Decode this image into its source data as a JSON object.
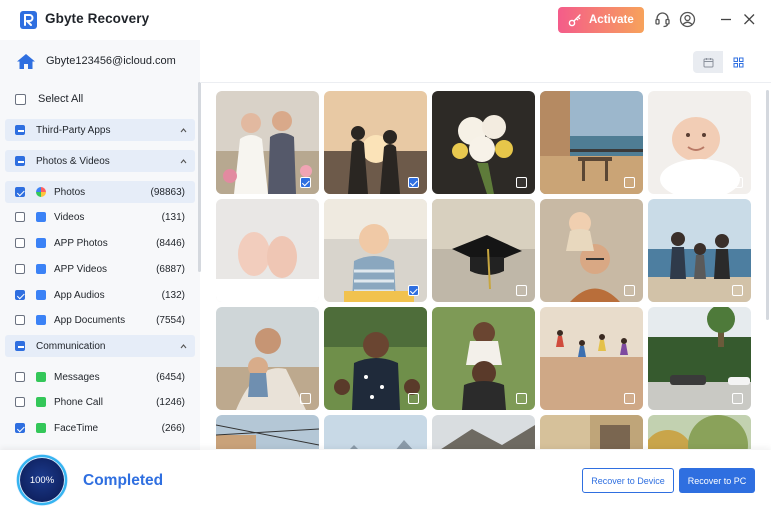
{
  "app": {
    "title": "Gbyte Recovery",
    "activate_label": "Activate",
    "colors": {
      "accent": "#2f6fe0",
      "activate_start": "#f45c8a",
      "activate_end": "#f7a25b"
    }
  },
  "titlebar_icons": [
    "headset-icon",
    "user-icon",
    "minimize-icon",
    "close-icon"
  ],
  "account": {
    "email": "Gbyte123456@icloud.com"
  },
  "sidebar": {
    "select_all_label": "Select All",
    "sections": [
      {
        "label": "Third-Party Apps",
        "state": "partial",
        "expanded": true
      },
      {
        "label": "Photos & Videos",
        "state": "partial",
        "expanded": true,
        "items": [
          {
            "label": "Photos",
            "count": "(98863)",
            "checked": true,
            "icon": "photos-icon",
            "color": "#ff6a6a"
          },
          {
            "label": "Videos",
            "count": "(131)",
            "checked": false,
            "icon": "videos-icon",
            "color": "#3b82f6"
          },
          {
            "label": "APP Photos",
            "count": "(8446)",
            "checked": false,
            "icon": "app-photos-icon",
            "color": "#3b82f6"
          },
          {
            "label": "APP Videos",
            "count": "(6887)",
            "checked": false,
            "icon": "app-videos-icon",
            "color": "#3b82f6"
          },
          {
            "label": "App Audios",
            "count": "(132)",
            "checked": true,
            "icon": "app-audios-icon",
            "color": "#3b82f6"
          },
          {
            "label": "App Documents",
            "count": "(7554)",
            "checked": false,
            "icon": "app-documents-icon",
            "color": "#3b82f6"
          }
        ]
      },
      {
        "label": "Communication",
        "state": "partial",
        "expanded": true,
        "items": [
          {
            "label": "Messages",
            "count": "(6454)",
            "checked": false,
            "icon": "messages-icon",
            "color": "#34c759"
          },
          {
            "label": "Phone Call",
            "count": "(1246)",
            "checked": false,
            "icon": "phone-call-icon",
            "color": "#34c759"
          },
          {
            "label": "FaceTime",
            "count": "(266)",
            "checked": true,
            "icon": "facetime-icon",
            "color": "#34c759"
          }
        ]
      }
    ]
  },
  "view_toggle": {
    "active": "calendar"
  },
  "photos": [
    {
      "subject": "wedding-couple",
      "checked": true
    },
    {
      "subject": "sunset-couple",
      "checked": true
    },
    {
      "subject": "flower-bouquet",
      "checked": false
    },
    {
      "subject": "balcony-table",
      "checked": false
    },
    {
      "subject": "smiling-baby",
      "checked": false
    },
    {
      "subject": "baby-feet",
      "checked": false
    },
    {
      "subject": "toddler-kitchen",
      "checked": true
    },
    {
      "subject": "graduation-cap",
      "checked": false
    },
    {
      "subject": "father-son",
      "checked": false
    },
    {
      "subject": "family-beach",
      "checked": false
    },
    {
      "subject": "mother-child-beach",
      "checked": false
    },
    {
      "subject": "man-with-kids",
      "checked": false
    },
    {
      "subject": "father-daughter",
      "checked": false
    },
    {
      "subject": "jumping-dunes",
      "checked": false
    },
    {
      "subject": "garden-street",
      "checked": false
    },
    {
      "subject": "street-wires",
      "checked": false
    },
    {
      "subject": "mountain-sky",
      "checked": false
    },
    {
      "subject": "rocky-hills",
      "checked": false
    },
    {
      "subject": "building-window",
      "checked": false
    },
    {
      "subject": "autumn-trees",
      "checked": false
    }
  ],
  "progress": {
    "value": 100,
    "label": "100%"
  },
  "status": "Completed",
  "buttons": {
    "recover_device": "Recover to Device",
    "recover_pc": "Recover to PC"
  }
}
